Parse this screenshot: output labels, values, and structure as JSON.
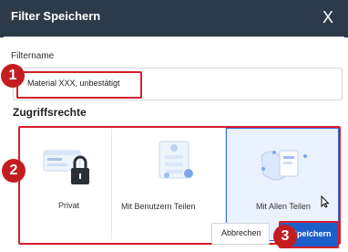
{
  "dialog": {
    "title": "Filter Speichern",
    "close_symbol": "X"
  },
  "fields": {
    "filtername_label": "Filtername",
    "filtername_value": "Material XXX, unbestätigt"
  },
  "access": {
    "section_title": "Zugriffsrechte",
    "options": [
      {
        "label": "Privat"
      },
      {
        "label": "Mit Benutzern Teilen"
      },
      {
        "label": "Mit Allen Teilen"
      }
    ]
  },
  "buttons": {
    "cancel": "Abbrechen",
    "save": "Speichern"
  },
  "annotations": {
    "badge_1": "1",
    "badge_2": "2",
    "badge_3": "3"
  },
  "colors": {
    "titlebar": "#2d3a4a",
    "accent": "#1d5fc8",
    "highlight": "#d61e2b"
  }
}
